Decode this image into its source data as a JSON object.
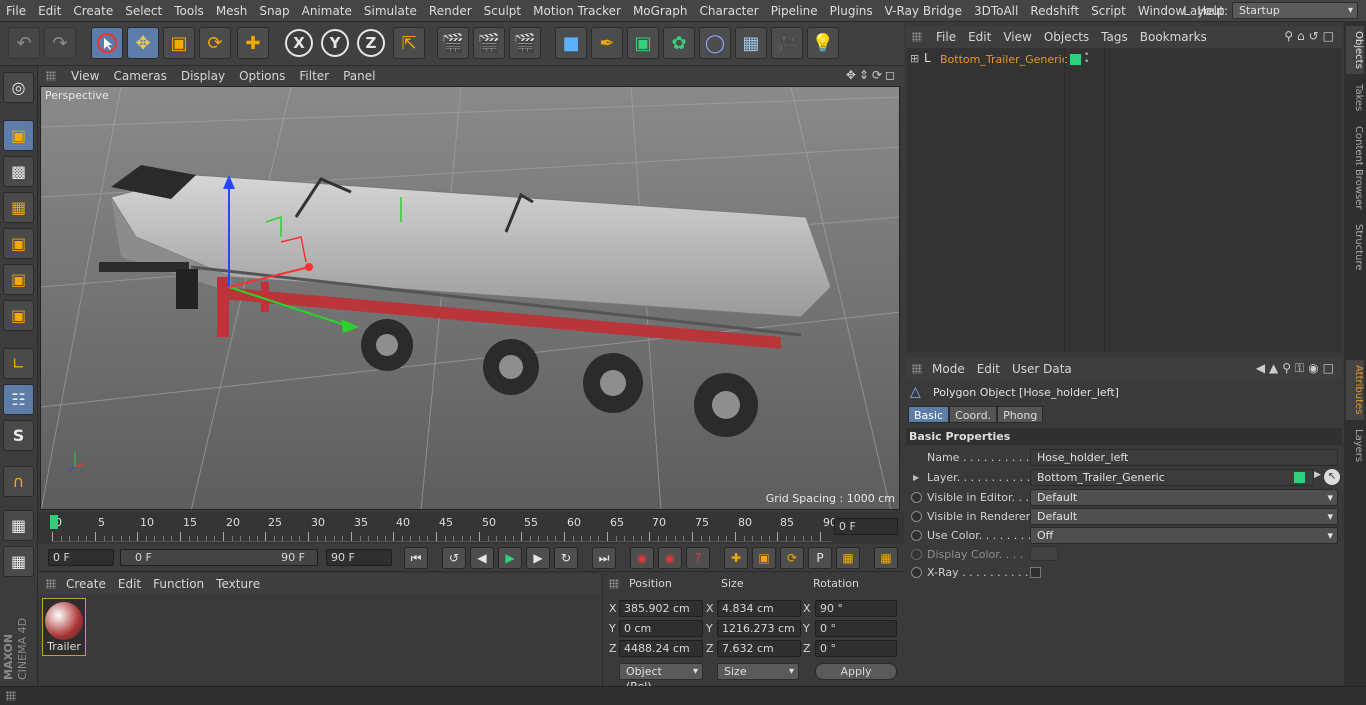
{
  "menubar": {
    "items": [
      "File",
      "Edit",
      "Create",
      "Select",
      "Tools",
      "Mesh",
      "Snap",
      "Animate",
      "Simulate",
      "Render",
      "Sculpt",
      "Motion Tracker",
      "MoGraph",
      "Character",
      "Pipeline",
      "Plugins",
      "V-Ray Bridge",
      "3DToAll",
      "Redshift",
      "Script",
      "Window",
      "Help"
    ],
    "layout_label": "Layout:",
    "layout_value": "Startup"
  },
  "toolbar": {
    "x_label": "X",
    "y_label": "Y",
    "z_label": "Z"
  },
  "viewport": {
    "menu": [
      "View",
      "Cameras",
      "Display",
      "Options",
      "Filter",
      "Panel"
    ],
    "camera_label": "Perspective",
    "grid_spacing": "Grid Spacing : 1000 cm"
  },
  "timeline": {
    "ticks": [
      "0",
      "5",
      "10",
      "15",
      "20",
      "25",
      "30",
      "35",
      "40",
      "45",
      "50",
      "55",
      "60",
      "65",
      "70",
      "75",
      "80",
      "85",
      "90"
    ],
    "current_frame": "0 F",
    "start_field": "0 F",
    "range_start": "0 F",
    "range_end": "90 F",
    "end_field": "90 F"
  },
  "materials": {
    "menu": [
      "Create",
      "Edit",
      "Function",
      "Texture"
    ],
    "items": [
      {
        "name": "Trailer"
      }
    ]
  },
  "coordinates": {
    "headers": {
      "position": "Position",
      "size": "Size",
      "rotation": "Rotation"
    },
    "rows": [
      {
        "axis": "X",
        "position": "385.902 cm",
        "size_axis": "X",
        "size": "4.834 cm",
        "rot_axis": "X",
        "rotation": "90 °"
      },
      {
        "axis": "Y",
        "position": "0 cm",
        "size_axis": "Y",
        "size": "1216.273 cm",
        "rot_axis": "Y",
        "rotation": "0 °"
      },
      {
        "axis": "Z",
        "position": "4488.24 cm",
        "size_axis": "Z",
        "size": "7.632 cm",
        "rot_axis": "Z",
        "rotation": "0 °"
      }
    ],
    "mode": "Object (Rel)",
    "size_mode": "Size",
    "apply": "Apply"
  },
  "objects": {
    "menu": [
      "File",
      "Edit",
      "View",
      "Objects",
      "Tags",
      "Bookmarks"
    ],
    "tree": [
      {
        "name": "Bottom_Trailer_Generic",
        "color": "#e39a2c"
      }
    ]
  },
  "attributes": {
    "menu": [
      "Mode",
      "Edit",
      "User Data"
    ],
    "title": "Polygon Object [Hose_holder_left]",
    "tabs": [
      "Basic",
      "Coord.",
      "Phong"
    ],
    "section": "Basic Properties",
    "props": [
      {
        "label": "Name . . . . . . . . . . .",
        "value": "Hose_holder_left"
      },
      {
        "label": "Layer. . . . . . . . . . .",
        "value": "Bottom_Trailer_Generic"
      },
      {
        "label": "Visible in Editor. . .",
        "value": "Default"
      },
      {
        "label": "Visible in Renderer",
        "value": "Default"
      },
      {
        "label": "Use Color. . . . . . . .",
        "value": "Off"
      },
      {
        "label": "Display Color. . . .",
        "value": ""
      },
      {
        "label": "X-Ray . . . . . . . . . .",
        "value": ""
      }
    ]
  },
  "side_tabs": {
    "top": [
      "Objects",
      "Takes",
      "Content Browser",
      "Structure"
    ],
    "bottom": [
      "Attributes",
      "Layers"
    ]
  },
  "branding": {
    "maxon": "MAXON",
    "product": "CINEMA 4D"
  },
  "colors": {
    "accent": "#5d7da8",
    "layer_green": "#2fd17a",
    "object_orange": "#e39a2c"
  }
}
